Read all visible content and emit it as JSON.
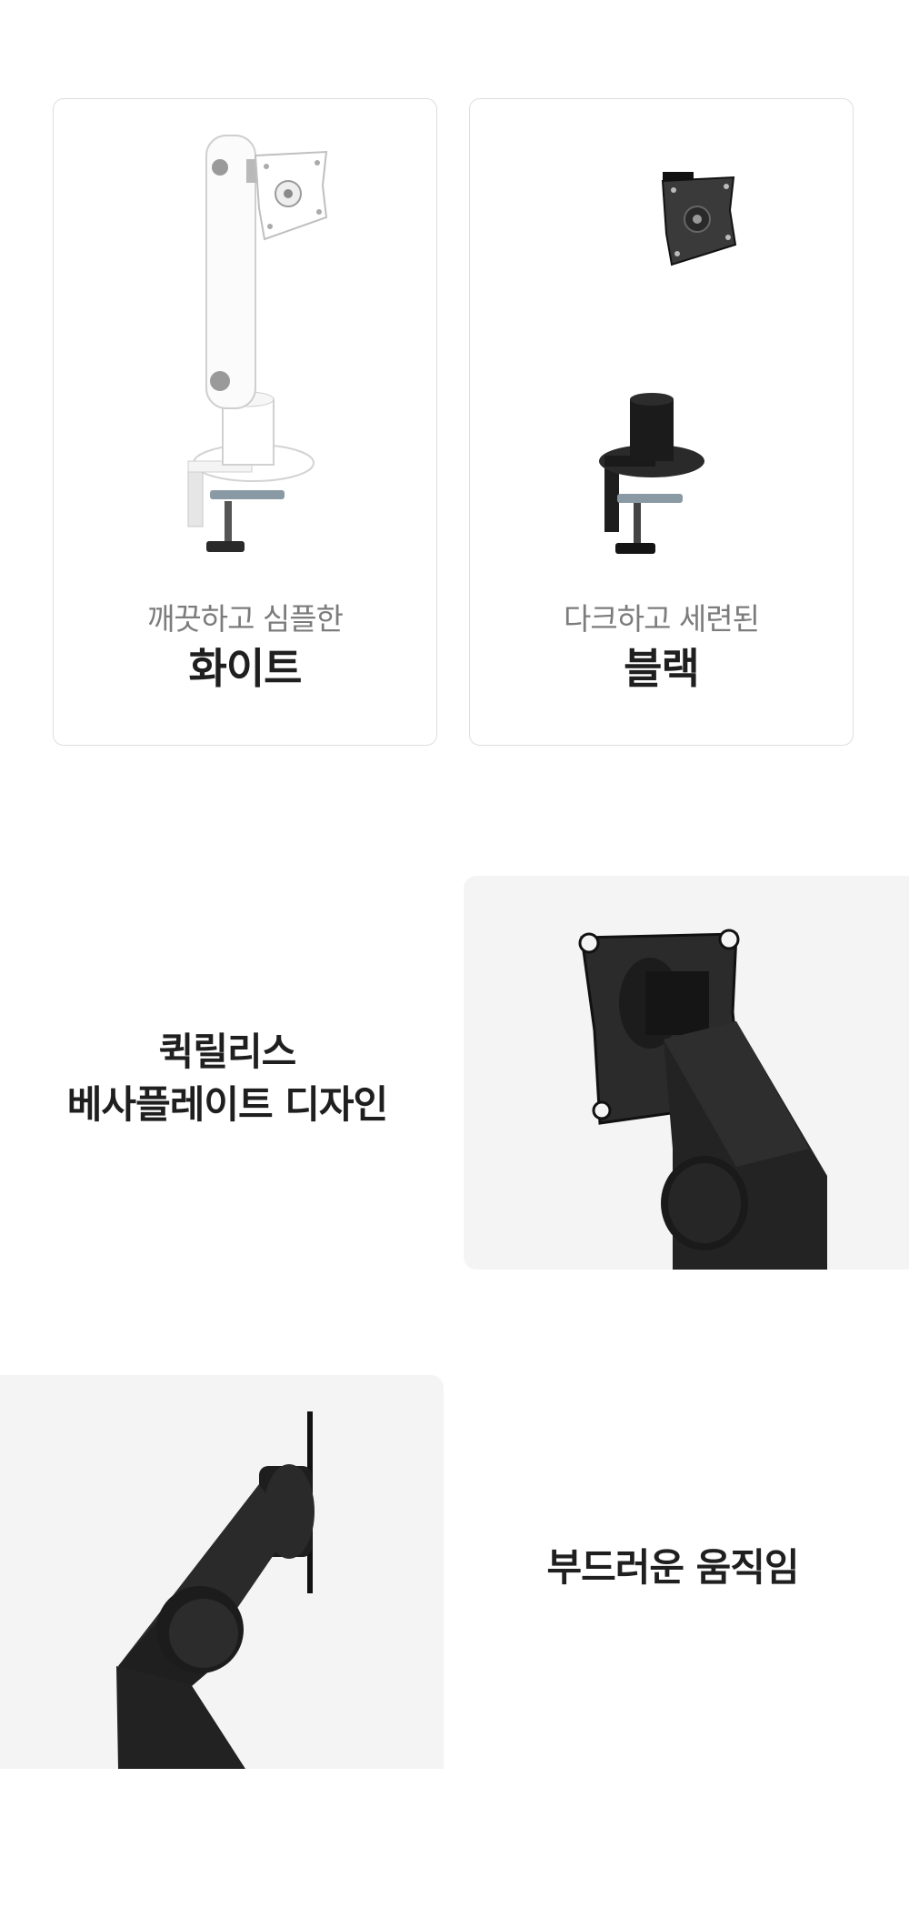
{
  "products": [
    {
      "subtitle": "깨끗하고 심플한",
      "title": "화이트",
      "color": "#f2f2f2"
    },
    {
      "subtitle": "다크하고 세련된",
      "title": "블랙",
      "color": "#1e1e1e"
    }
  ],
  "features": [
    {
      "line1": "퀵릴리스",
      "line2": "베사플레이트 디자인"
    },
    {
      "line1": "부드러운 움직임"
    }
  ]
}
